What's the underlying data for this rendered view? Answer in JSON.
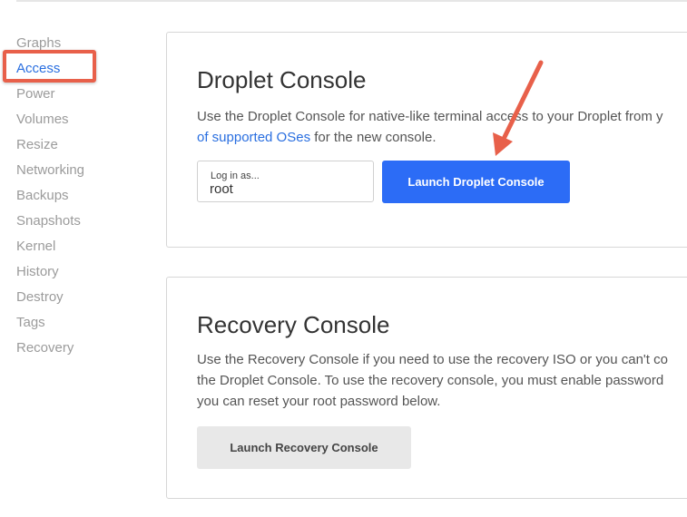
{
  "sidebar": {
    "items": [
      {
        "label": "Graphs"
      },
      {
        "label": "Access"
      },
      {
        "label": "Power"
      },
      {
        "label": "Volumes"
      },
      {
        "label": "Resize"
      },
      {
        "label": "Networking"
      },
      {
        "label": "Backups"
      },
      {
        "label": "Snapshots"
      },
      {
        "label": "Kernel"
      },
      {
        "label": "History"
      },
      {
        "label": "Destroy"
      },
      {
        "label": "Tags"
      },
      {
        "label": "Recovery"
      }
    ],
    "active": "Access"
  },
  "droplet_console": {
    "title": "Droplet Console",
    "description_line1": "Use the Droplet Console for native-like terminal access to your Droplet from y",
    "description_link": "of supported OSes",
    "description_line2_rest": " for the new console.",
    "login_label": "Log in as...",
    "login_value": "root",
    "launch_button": "Launch Droplet Console"
  },
  "recovery_console": {
    "title": "Recovery Console",
    "description_line1": "Use the Recovery Console if you need to use the recovery ISO or you can't co",
    "description_line2": "the Droplet Console. To use the recovery console, you must enable password",
    "description_line3": "you can reset your root password below.",
    "launch_button": "Launch Recovery Console"
  },
  "annotations": {
    "highlight_color": "#e8604a",
    "arrow_color": "#e8604a"
  },
  "colors": {
    "accent": "#2a6fe0",
    "primary_button": "#2c6cf6",
    "secondary_button": "#e8e8e8"
  }
}
